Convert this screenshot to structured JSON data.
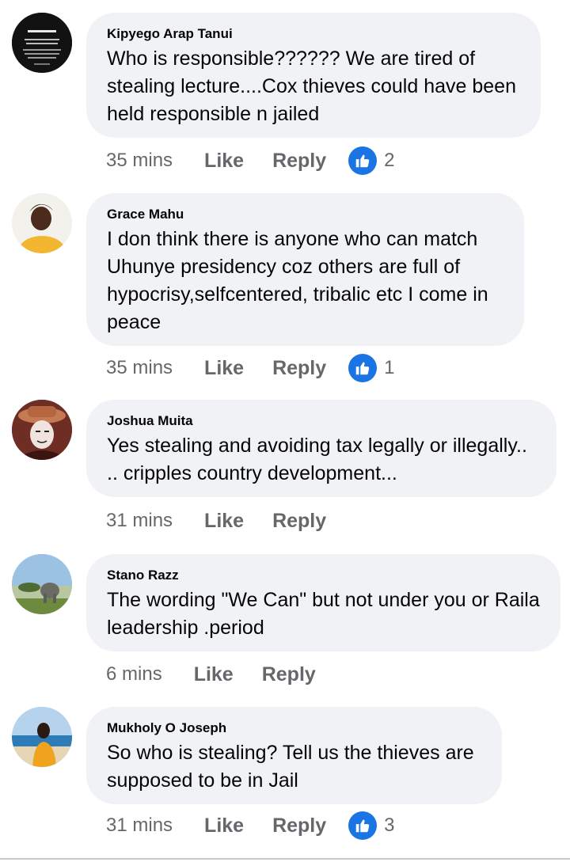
{
  "comments": [
    {
      "author": "Kipyego Arap Tanui",
      "text": "Who is responsible?????? We are tired of\nstealing lecture....Cox thieves could have been\nheld responsible n jailed",
      "time": "35 mins",
      "like_label": "Like",
      "reply_label": "Reply",
      "reaction_count": "2",
      "avatar": "avatar-text-poster"
    },
    {
      "author": "Grace Mahu",
      "text": "I don think there is anyone who can match\nUhunye presidency coz others are full of\nhypocrisy,selfcentered, tribalic etc I come in\npeace",
      "time": "35 mins",
      "like_label": "Like",
      "reply_label": "Reply",
      "reaction_count": "1",
      "avatar": "avatar-woman-yellow"
    },
    {
      "author": "Joshua Muita",
      "text": "Yes stealing and avoiding tax legally or illegally..\n.. cripples country development...",
      "time": "31 mins",
      "like_label": "Like",
      "reply_label": "Reply",
      "avatar": "avatar-mask-hat"
    },
    {
      "author": "Stano Razz",
      "text": "The wording \"We Can\" but not under you or Raila\nleadership .period",
      "time": "6 mins",
      "like_label": "Like",
      "reply_label": "Reply",
      "avatar": "avatar-elephant-landscape"
    },
    {
      "author": "Mukholy O Joseph",
      "text": "So who is stealing? Tell us the thieves are\nsupposed to be  in Jail",
      "time": "31 mins",
      "like_label": "Like",
      "reply_label": "Reply",
      "reaction_count": "3",
      "avatar": "avatar-man-beach"
    }
  ],
  "colors": {
    "bubble": "#f0f2f5",
    "meta_text": "#65676b",
    "like_blue": "#1b74e4"
  },
  "icons": {
    "reaction": "thumbs-up-icon"
  }
}
